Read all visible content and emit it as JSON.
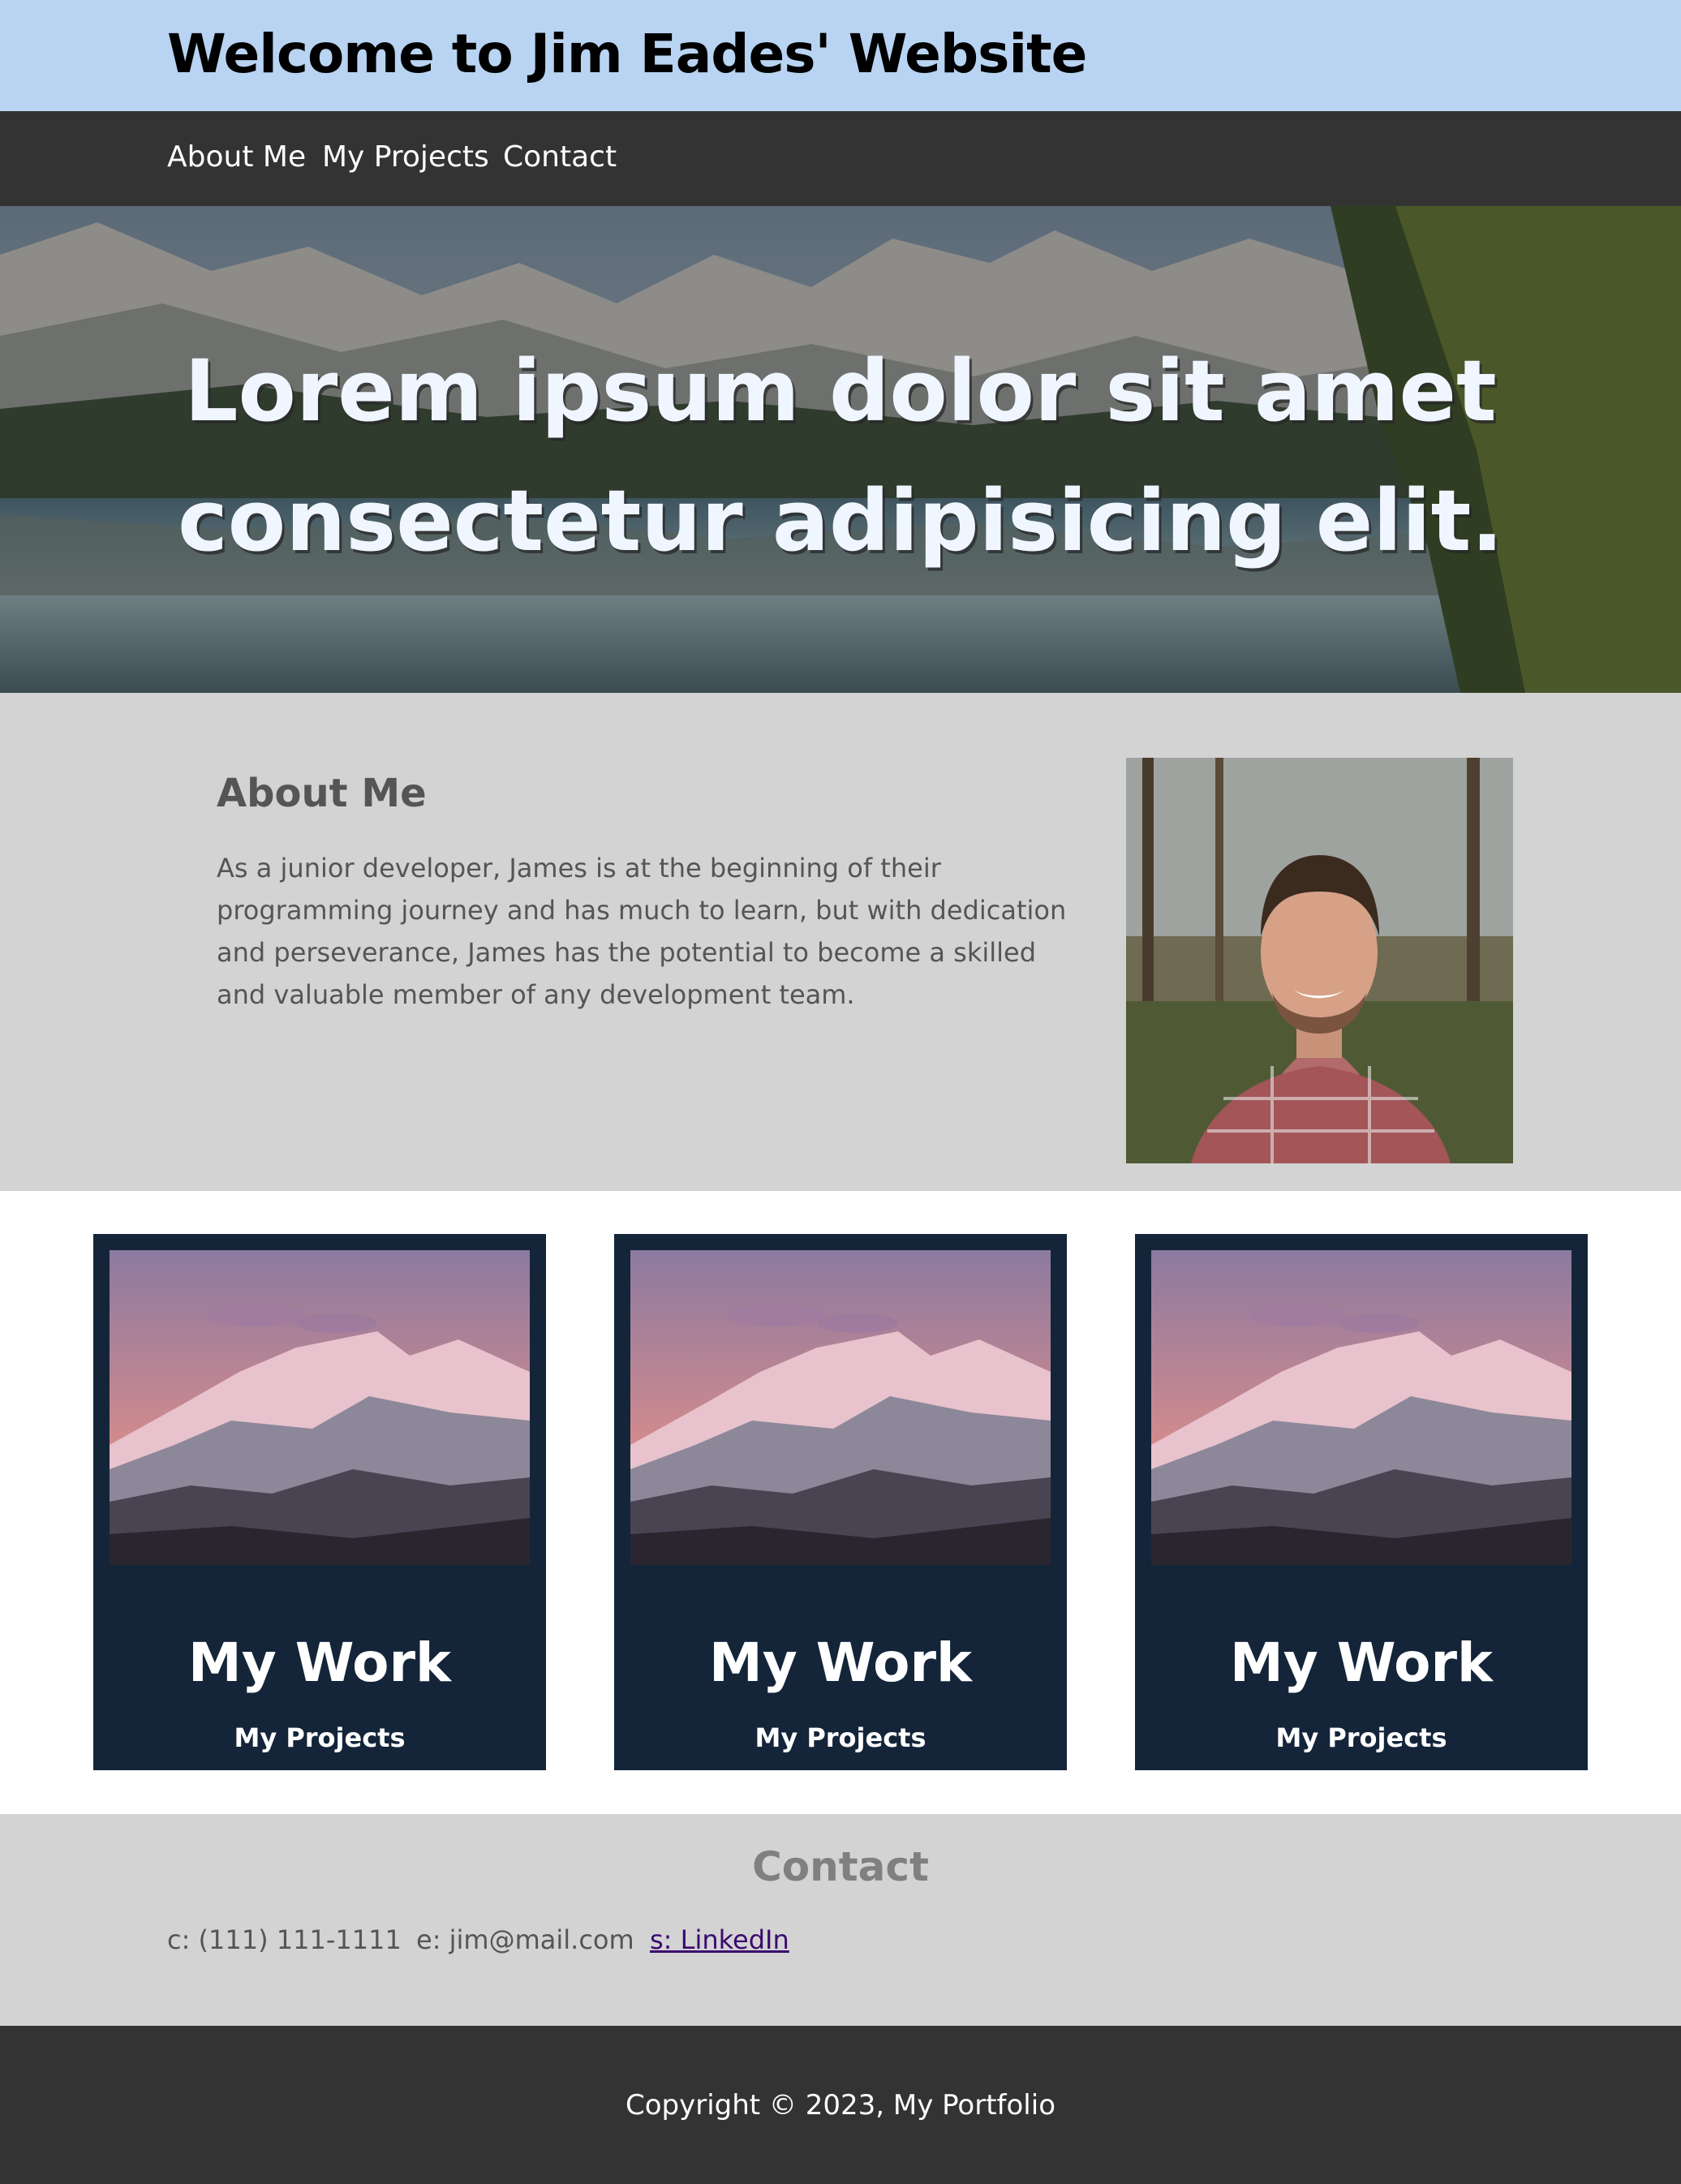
{
  "header": {
    "title": "Welcome to Jim Eades' Website"
  },
  "nav": {
    "items": [
      "About Me",
      "My Projects",
      "Contact"
    ]
  },
  "hero": {
    "line1": "Lorem ipsum dolor sit amet",
    "line2": "consectetur adipisicing elit."
  },
  "about": {
    "heading": "About Me",
    "text": "As a junior developer, James is at the beginning of their programming journey and has much to learn, but with dedication and perseverance, James has the potential to become a skilled and valuable member of any development team."
  },
  "cards": [
    {
      "title": "My Work",
      "subtitle": "My Projects"
    },
    {
      "title": "My Work",
      "subtitle": "My Projects"
    },
    {
      "title": "My Work",
      "subtitle": "My Projects"
    }
  ],
  "contact": {
    "heading": "Contact",
    "phone": "c: (111) 111-1111",
    "email": "e: jim@mail.com",
    "social": "s: LinkedIn"
  },
  "footer": {
    "copyright": "Copyright © 2023, My Portfolio"
  },
  "colors": {
    "header_bg": "#b9d4f2",
    "nav_bg": "#333333",
    "section_bg": "#d3d3d3",
    "card_bg": "#14253a",
    "link": "#3a0a6e"
  }
}
